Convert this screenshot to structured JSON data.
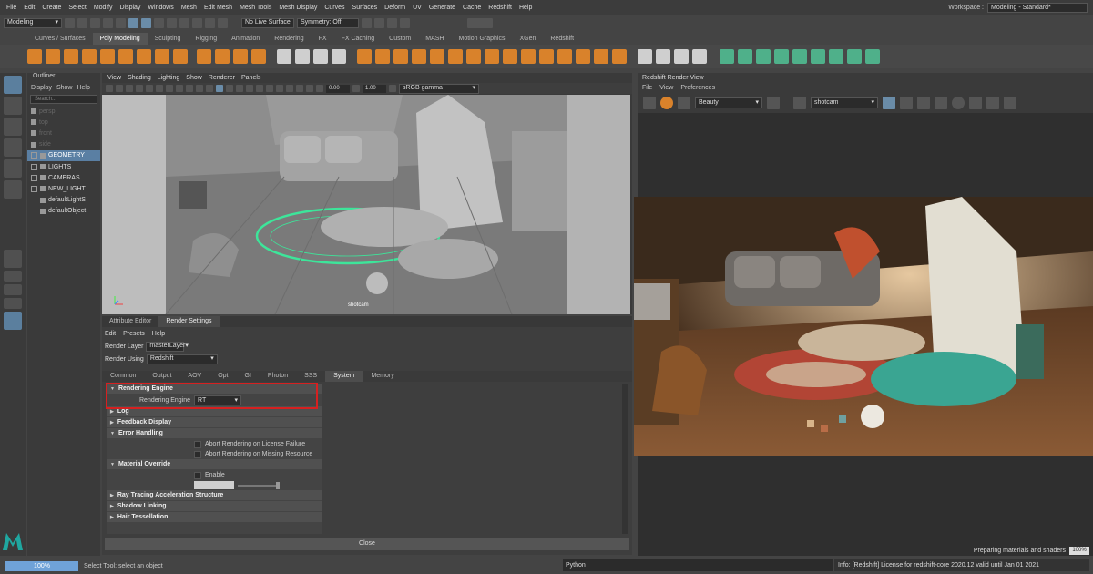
{
  "menubar": {
    "items": [
      "File",
      "Edit",
      "Create",
      "Select",
      "Modify",
      "Display",
      "Windows",
      "Mesh",
      "Edit Mesh",
      "Mesh Tools",
      "Mesh Display",
      "Curves",
      "Surfaces",
      "Deform",
      "UV",
      "Generate",
      "Cache",
      "Redshift",
      "Help"
    ],
    "workspace_label": "Workspace :",
    "workspace_value": "Modeling - Standard*"
  },
  "statusline": {
    "mode": "Modeling",
    "live_surface": "No Live Surface",
    "symmetry": "Symmetry: Off"
  },
  "shelf_tabs": [
    "Curves / Surfaces",
    "Poly Modeling",
    "Sculpting",
    "Rigging",
    "Animation",
    "Rendering",
    "FX",
    "FX Caching",
    "Custom",
    "MASH",
    "Motion Graphics",
    "XGen",
    "Redshift"
  ],
  "shelf_active": "Poly Modeling",
  "outliner": {
    "title": "Outliner",
    "menu": [
      "Display",
      "Show",
      "Help"
    ],
    "search_placeholder": "Search...",
    "items": [
      {
        "label": "persp",
        "dim": true
      },
      {
        "label": "top",
        "dim": true
      },
      {
        "label": "front",
        "dim": true
      },
      {
        "label": "side",
        "dim": true
      },
      {
        "label": "GEOMETRY",
        "selected": true
      },
      {
        "label": "LIGHTS"
      },
      {
        "label": "CAMERAS"
      },
      {
        "label": "NEW_LIGHT"
      },
      {
        "label": "defaultLightS"
      },
      {
        "label": "defaultObject"
      }
    ]
  },
  "viewport": {
    "menu": [
      "View",
      "Shading",
      "Lighting",
      "Show",
      "Renderer",
      "Panels"
    ],
    "value1": "0.00",
    "value2": "1.00",
    "colorspace": "sRGB gamma",
    "camera_label": "shotcam"
  },
  "redshift": {
    "title": "Redshift Render View",
    "menu": [
      "File",
      "View",
      "Preferences"
    ],
    "aov": "Beauty",
    "camera": "shotcam",
    "status": "Preparing materials and shaders",
    "progress": "100%"
  },
  "render_settings": {
    "tabs": [
      "Attribute Editor",
      "Render Settings"
    ],
    "active_tab": "Render Settings",
    "menu": [
      "Edit",
      "Presets",
      "Help"
    ],
    "render_layer_label": "Render Layer",
    "render_layer_value": "masterLayer",
    "render_using_label": "Render Using",
    "render_using_value": "Redshift",
    "subtabs": [
      "Common",
      "Output",
      "AOV",
      "Opt",
      "GI",
      "Photon",
      "SSS",
      "System",
      "Memory"
    ],
    "active_subtab": "System",
    "sections": {
      "rendering_engine": "Rendering Engine",
      "engine_label": "Rendering Engine",
      "engine_value": "RT",
      "log": "Log",
      "feedback": "Feedback Display",
      "error_handling": "Error Handling",
      "abort_license": "Abort Rendering on License Failure",
      "abort_missing": "Abort Rendering on Missing Resource",
      "material_override": "Material Override",
      "enable": "Enable",
      "ray_tracing": "Ray Tracing Acceleration Structure",
      "shadow_linking": "Shadow Linking",
      "hair": "Hair Tessellation"
    },
    "close": "Close"
  },
  "helpline": {
    "progress": "100%",
    "help_text": "Select Tool: select an object",
    "python_label": "Python",
    "info": "Info:  [Redshift] License for redshift-core 2020.12 valid until Jan 01 2021"
  },
  "colors": {
    "accent": "#5a7fa3",
    "highlight_red": "#d62020",
    "maya_logo": "#1fa7a0",
    "shelf_orange": "#d9822b",
    "shelf_green": "#4fb08a"
  }
}
